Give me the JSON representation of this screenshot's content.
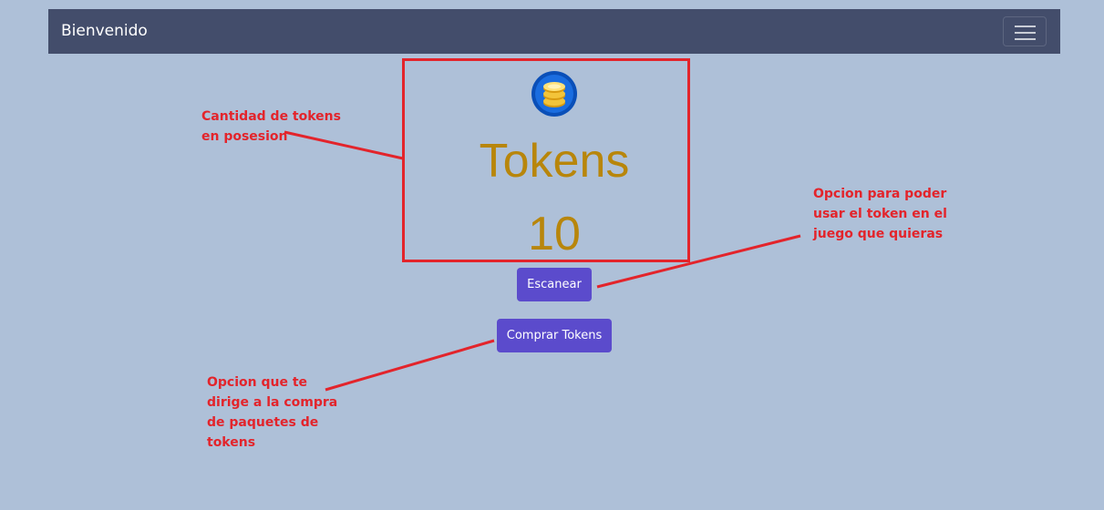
{
  "navbar": {
    "brand": "Bienvenido",
    "menu_icon": "hamburger-menu-icon"
  },
  "wallet": {
    "icon": "coin-stack-icon",
    "title": "Tokens",
    "count": "10"
  },
  "actions": {
    "scan_label": "Escanear",
    "buy_label": "Comprar Tokens"
  },
  "annotations": {
    "tokens_note_line1": "Cantidad de tokens",
    "tokens_note_line2": "en posesion",
    "scan_note_line1": "Opcion para poder",
    "scan_note_line2": "usar el token en el",
    "scan_note_line3": "juego que quieras",
    "buy_note_line1": "Opcion que te",
    "buy_note_line2": "dirige a la compra",
    "buy_note_line3": "de paquetes de",
    "buy_note_line4": "tokens"
  },
  "colors": {
    "background": "#aec0d8",
    "navbar": "#434d6b",
    "button": "#5b4bcc",
    "token_text": "#b8860b",
    "annotation": "#e3242b"
  }
}
